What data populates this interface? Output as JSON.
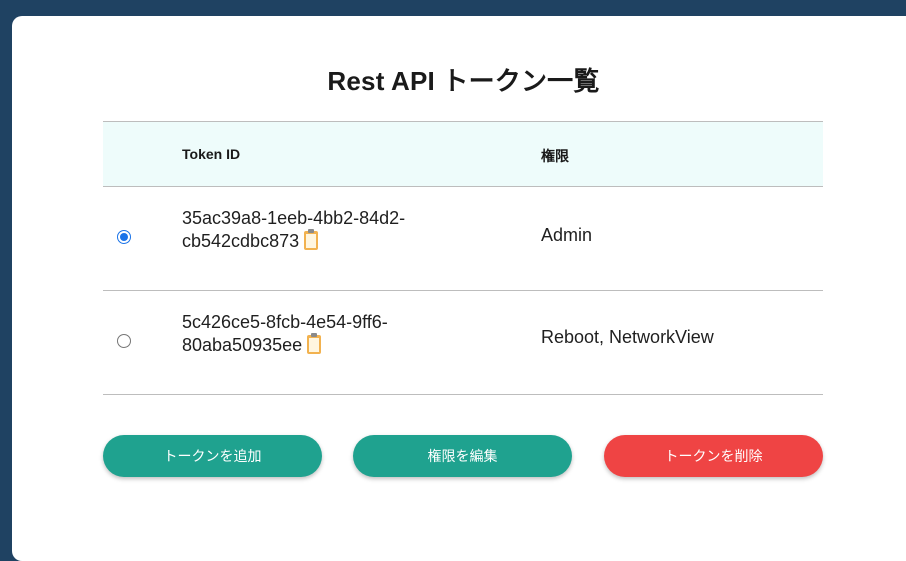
{
  "page": {
    "title": "Rest API トークン一覧"
  },
  "table": {
    "headers": {
      "token_id": "Token ID",
      "permission": "権限"
    },
    "rows": [
      {
        "selected": true,
        "token_line1": "35ac39a8-1eeb-4bb2-84d2-",
        "token_line2": "cb542cdbc873",
        "permission": "Admin"
      },
      {
        "selected": false,
        "token_line1": "5c426ce5-8fcb-4e54-9ff6-",
        "token_line2": "80aba50935ee",
        "permission": "Reboot, NetworkView"
      }
    ]
  },
  "actions": {
    "add_label": "トークンを追加",
    "edit_label": "権限を編集",
    "delete_label": "トークンを削除"
  },
  "colors": {
    "background": "#1f4262",
    "header_bg": "#eefcfb",
    "teal_button": "#1fa28f",
    "red_button": "#ef4444",
    "radio_accent": "#1a73e8",
    "clipboard": "#f2b24f"
  },
  "icons": {
    "copy": "clipboard-icon"
  }
}
